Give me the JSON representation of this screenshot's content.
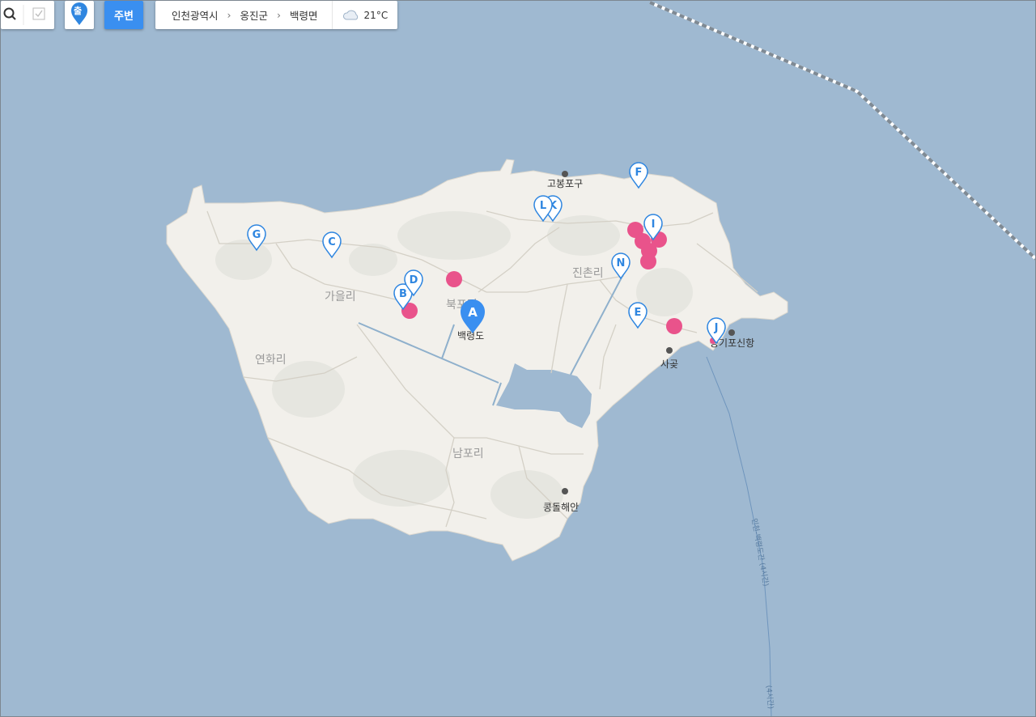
{
  "toolbar": {
    "search_icon": "magnifier",
    "check_icon": "checkbox-outline",
    "marker_button_label": "출",
    "nearby_button_label": "주변"
  },
  "breadcrumb": {
    "items": [
      "인천광역시",
      "옹진군",
      "백령면"
    ],
    "separator": "›"
  },
  "weather": {
    "icon": "cloud-icon",
    "temperature": "21°C"
  },
  "map": {
    "place_labels": {
      "gabul_ri": "가을리",
      "buk_po_ri": "북포리",
      "yeonhwa_ri": "연화리",
      "jinchon_ri": "진촌리",
      "nampo_ri": "남포리"
    },
    "poi_labels": {
      "gobongpogu": "고봉포구",
      "yonggipo": "용기포신항",
      "sagot": "사곶",
      "kongdol": "콩돌해안",
      "baengnyeongdo": "백령도"
    },
    "ferry_route_label": "인천-백령도간 (4시간)",
    "ferry_route_label_2": "(4시간)",
    "main_marker": "A",
    "markers": [
      "B",
      "C",
      "D",
      "E",
      "F",
      "G",
      "I",
      "J",
      "K",
      "L",
      "N"
    ],
    "colors": {
      "sea": "#9fb9d1",
      "land": "#f2f0eb",
      "green": "#e6e6e0",
      "marker_blue": "#2f86e0",
      "lodging_pink": "#e9538b",
      "active_blue": "#3a8ff0"
    }
  }
}
